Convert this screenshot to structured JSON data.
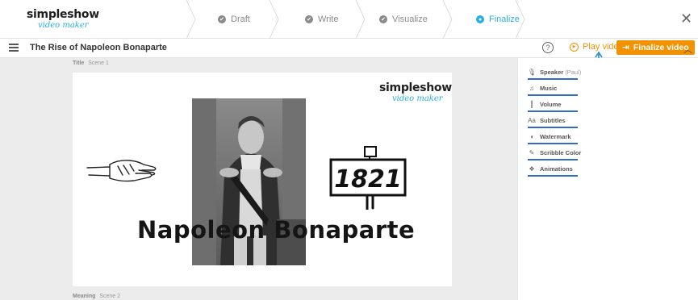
{
  "app": {
    "logo_main": "simpleshow",
    "logo_sub": "video maker"
  },
  "steps": [
    {
      "label": "Draft",
      "state": "done"
    },
    {
      "label": "Write",
      "state": "done"
    },
    {
      "label": "Visualize",
      "state": "done"
    },
    {
      "label": "Finalize",
      "state": "active"
    }
  ],
  "toolbar": {
    "project_title": "The Rise of Napoleon Bonaparte",
    "help_glyph": "?",
    "play_label": "Play video",
    "finalize_label": "Finalize video"
  },
  "scenes": [
    {
      "title": "Title",
      "subtitle": "Scene 1"
    },
    {
      "title": "Meaning",
      "subtitle": "Scene 2"
    }
  ],
  "canvas": {
    "year": "1821",
    "caption": "Napoleon Bonaparte",
    "logo_main": "simpleshow",
    "logo_sub": "video maker"
  },
  "properties": [
    {
      "label": "Speaker",
      "extra": "(Paul)",
      "icon": "microphone-icon"
    },
    {
      "label": "Music",
      "extra": "",
      "icon": "music-note-icon"
    },
    {
      "label": "Volume",
      "extra": "",
      "icon": "volume-bars-icon"
    },
    {
      "label": "Subtitles",
      "extra": "",
      "icon": "subtitles-icon"
    },
    {
      "label": "Watermark",
      "extra": "",
      "icon": "watermark-icon"
    },
    {
      "label": "Scribble Color",
      "extra": "",
      "icon": "pen-icon"
    },
    {
      "label": "Animations",
      "extra": "",
      "icon": "animations-icon"
    }
  ],
  "colors": {
    "accent_blue": "#2aaee2",
    "orange": "#f39200",
    "underline_blue": "#2f6dc7"
  }
}
